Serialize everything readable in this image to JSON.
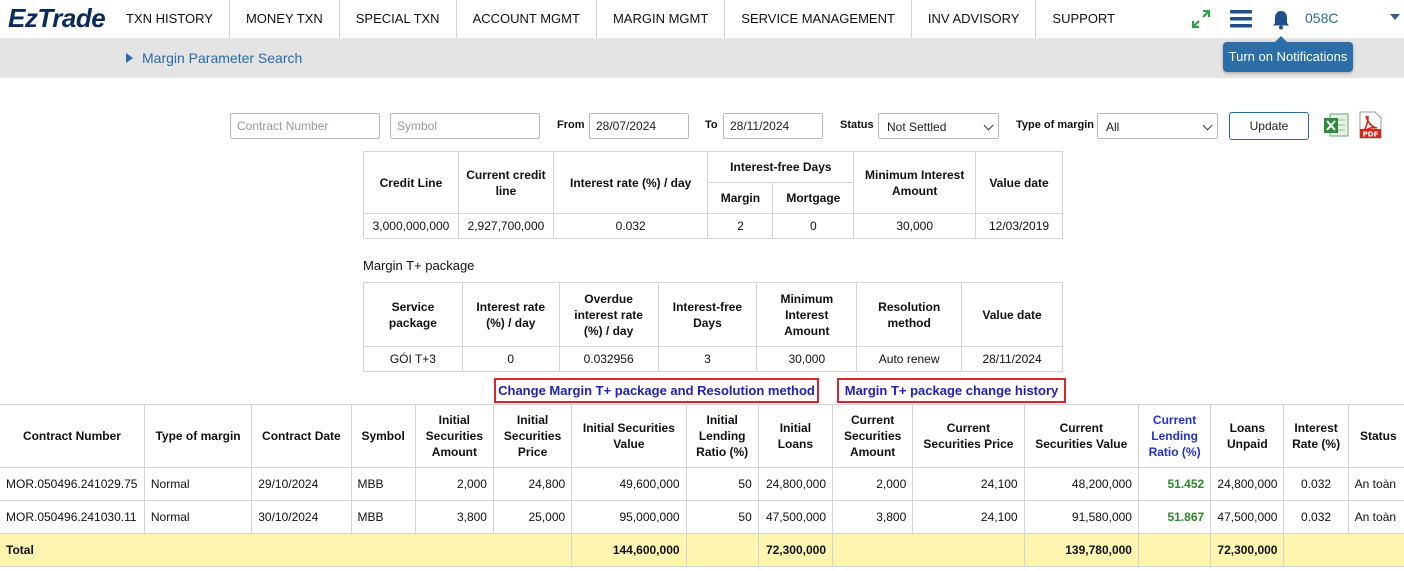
{
  "app": {
    "logo": "EzTrade"
  },
  "nav": {
    "items": [
      "TXN HISTORY",
      "MONEY TXN",
      "SPECIAL TXN",
      "ACCOUNT MGMT",
      "MARGIN MGMT",
      "SERVICE MANAGEMENT",
      "INV ADVISORY",
      "SUPPORT"
    ],
    "account": "058C",
    "icons": [
      "expand-arrows-icon",
      "hamburger-menu-icon",
      "bell-icon",
      "caret-down-icon"
    ]
  },
  "breadcrumb": {
    "label": "Margin Parameter Search"
  },
  "tooltip": {
    "text": "Turn on Notifications"
  },
  "filters": {
    "contract_placeholder": "Contract Number",
    "symbol_placeholder": "Symbol",
    "from_label": "From",
    "from_value": "28/07/2024",
    "to_label": "To",
    "to_value": "28/11/2024",
    "status_label": "Status",
    "status_value": "Not Settled",
    "type_label": "Type of margin",
    "type_value": "All",
    "update_label": "Update",
    "export_icons": [
      "excel-export-icon",
      "pdf-export-icon"
    ]
  },
  "credit": {
    "headers": {
      "credit_line": "Credit Line",
      "current_credit_line": "Current credit line",
      "interest_rate": "Interest rate (%) / day",
      "interest_free_days": "Interest-free Days",
      "margin": "Margin",
      "mortgage": "Mortgage",
      "min_interest": "Minimum Interest Amount",
      "value_date": "Value date"
    },
    "row": [
      "3,000,000,000",
      "2,927,700,000",
      "0.032",
      "2",
      "0",
      "30,000",
      "12/03/2019"
    ]
  },
  "tplus": {
    "title": "Margin T+ package",
    "headers": [
      "Service package",
      "Interest rate (%) / day",
      "Overdue interest rate (%) / day",
      "Interest-free Days",
      "Minimum Interest Amount",
      "Resolution method",
      "Value date"
    ],
    "row": [
      "GÓI T+3",
      "0",
      "0.032956",
      "3",
      "30,000",
      "Auto renew",
      "28/11/2024"
    ]
  },
  "links": {
    "change": "Change Margin T+ package and Resolution method",
    "history": "Margin T+ package change history"
  },
  "main": {
    "headers": [
      "Contract Number",
      "Type of margin",
      "Contract Date",
      "Symbol",
      "Initial Securities Amount",
      "Initial Securities Price",
      "Initial Securities Value",
      "Initial Lending Ratio (%)",
      "Initial Loans",
      "Current Securities Amount",
      "Current Securities Price",
      "Current Securities Value",
      "Current Lending Ratio (%)",
      "Loans Unpaid",
      "Interest Rate (%)",
      "Status"
    ],
    "rows": [
      [
        "MOR.050496.241029.75",
        "Normal",
        "29/10/2024",
        "MBB",
        "2,000",
        "24,800",
        "49,600,000",
        "50",
        "24,800,000",
        "2,000",
        "24,100",
        "48,200,000",
        "51.452",
        "24,800,000",
        "0.032",
        "An toàn"
      ],
      [
        "MOR.050496.241030.11",
        "Normal",
        "30/10/2024",
        "MBB",
        "3,800",
        "25,000",
        "95,000,000",
        "50",
        "47,500,000",
        "3,800",
        "24,100",
        "91,580,000",
        "51.867",
        "47,500,000",
        "0.032",
        "An toàn"
      ]
    ],
    "total": {
      "label": "Total",
      "initial_value": "144,600,000",
      "initial_loans": "72,300,000",
      "current_value": "139,780,000",
      "loans_unpaid": "72,300,000"
    }
  },
  "colors": {
    "brand": "#0b2a5c",
    "link": "#2a6aa8",
    "highlight_border": "#d9262c",
    "total_bg": "#fdf5b0",
    "ratio_green": "#2a8a2a"
  }
}
